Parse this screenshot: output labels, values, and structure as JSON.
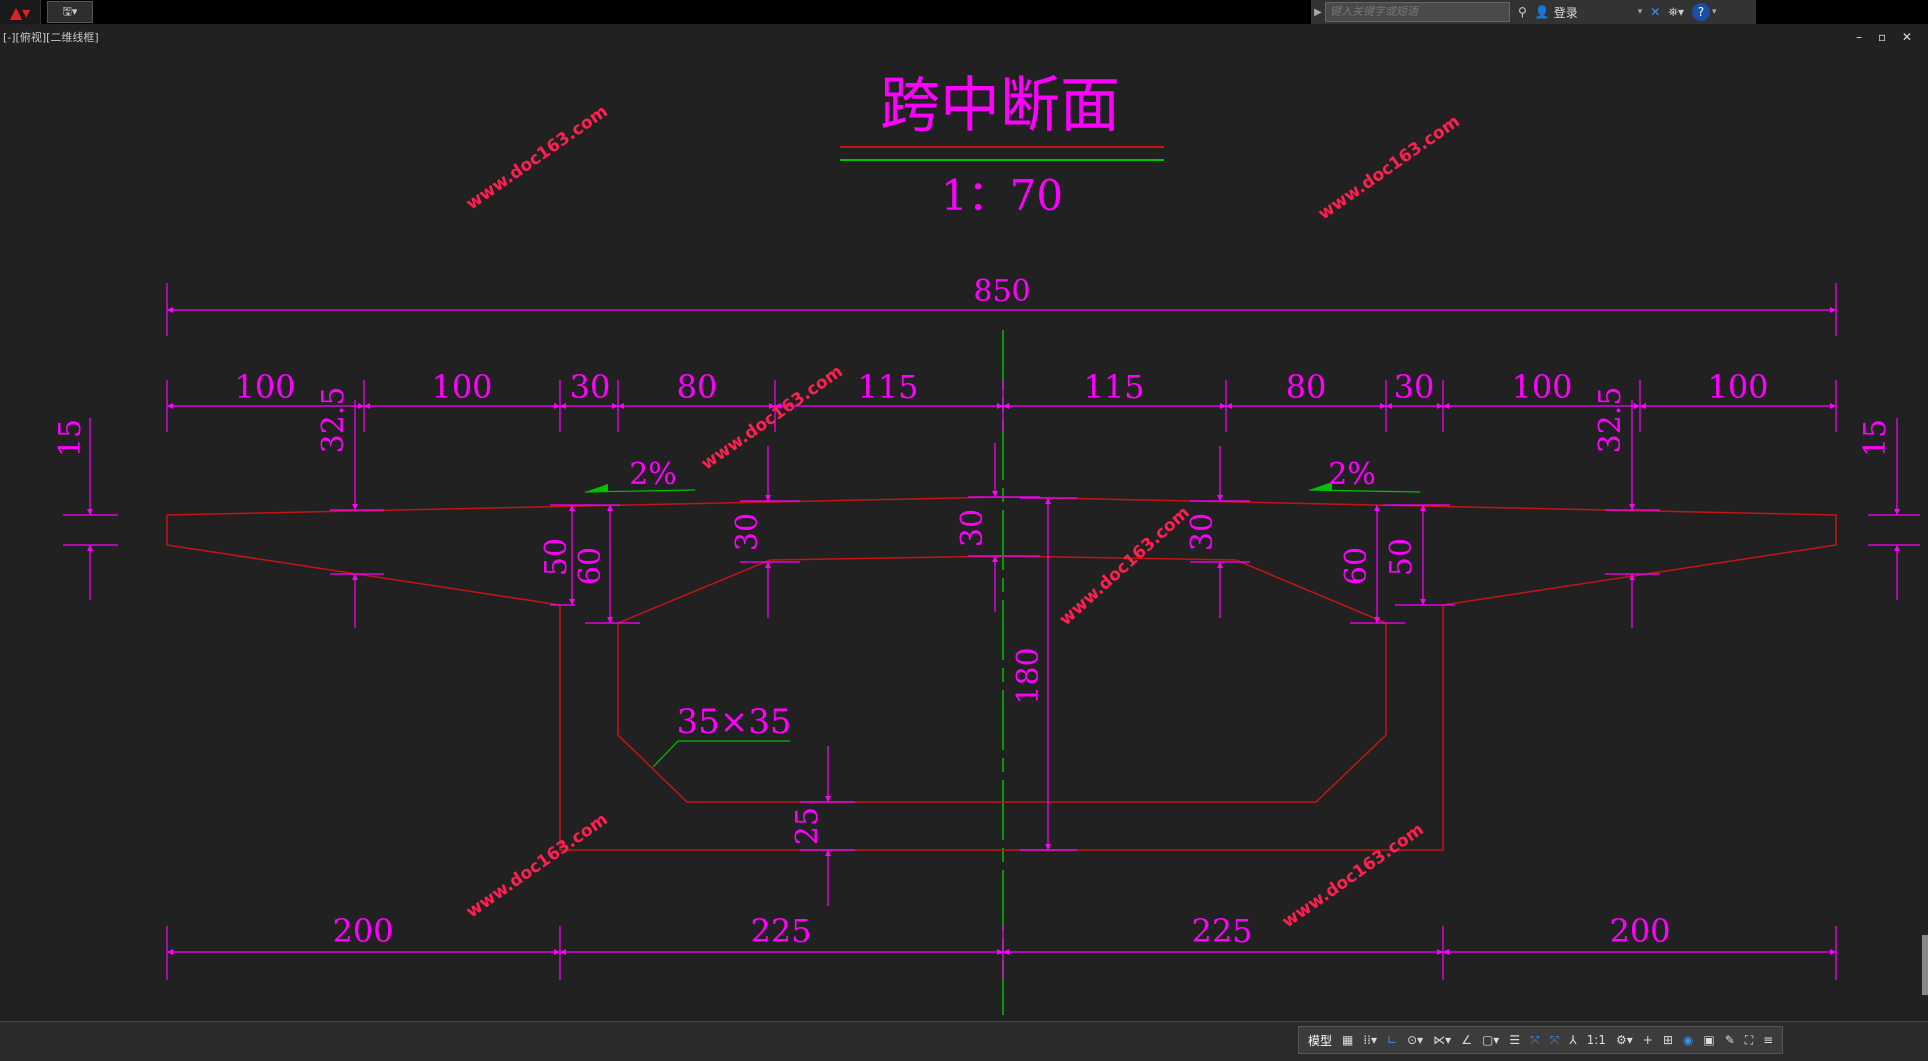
{
  "app": {
    "logo": "autocad-logo-icon",
    "view_label": "[-][俯视][二维线框]",
    "search_placeholder": "键入关键字或短语",
    "login_label": "登录",
    "window_controls": "– ▫ ✕"
  },
  "drawing": {
    "title": "跨中断面",
    "scale": "1：70",
    "watermark": "www.doc163.com",
    "dims": {
      "total_width": "850",
      "top_segments": [
        "100",
        "100",
        "30",
        "80",
        "115",
        "115",
        "80",
        "30",
        "100",
        "100"
      ],
      "bottom_segments": [
        "200",
        "225",
        "225",
        "200"
      ],
      "edge_thickness": "15",
      "cantilever_root": "32.5",
      "web_depth_50": "50",
      "web_depth_60": "60",
      "top_slab_30": "30",
      "height": "180",
      "bottom_slab": "25",
      "chamfer": "35×35",
      "slope": "2%"
    },
    "colors": {
      "dimension": "#ff00ff",
      "section": "#c41515",
      "centerline": "#00c000",
      "watermark": "#ff2050"
    }
  },
  "statusbar": {
    "model_label": "模型",
    "scale_label": "1:1"
  }
}
